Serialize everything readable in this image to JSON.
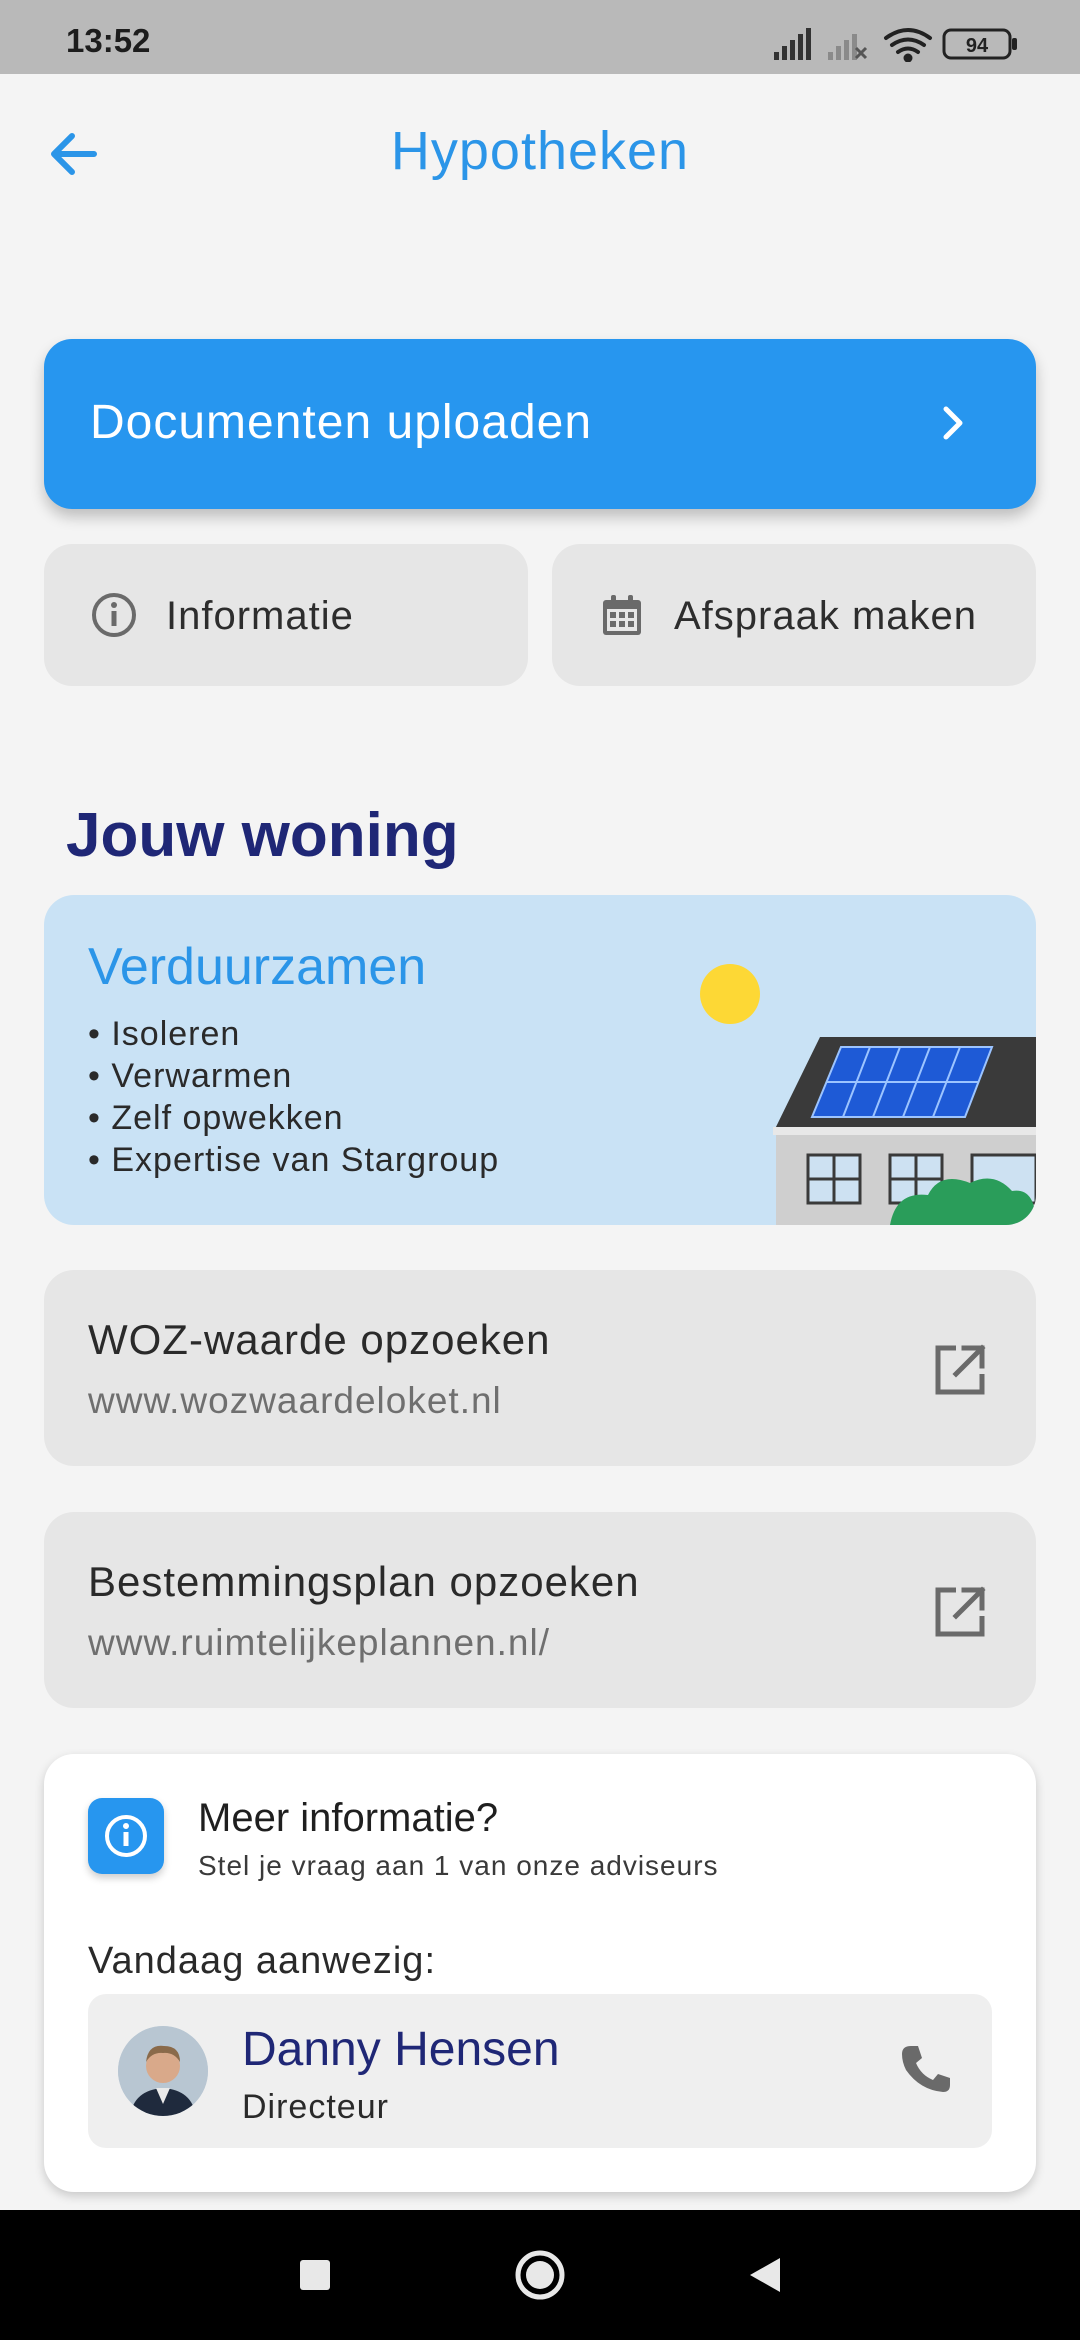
{
  "status_bar": {
    "time": "13:52",
    "battery": "94"
  },
  "header": {
    "title": "Hypotheken",
    "back_icon": "arrow-left-icon"
  },
  "actions": {
    "upload_label": "Documenten uploaden",
    "info_label": "Informatie",
    "appointment_label": "Afspraak maken"
  },
  "section": {
    "title": "Jouw woning"
  },
  "sustain_card": {
    "title": "Verduurzamen",
    "items": [
      "Isoleren",
      "Verwarmen",
      "Zelf opwekken",
      "Expertise van Stargroup"
    ]
  },
  "links": [
    {
      "title": "WOZ-waarde opzoeken",
      "url": "www.wozwaardeloket.nl"
    },
    {
      "title": "Bestemmingsplan opzoeken",
      "url": "www.ruimtelijkeplannen.nl/"
    }
  ],
  "contact": {
    "title": "Meer informatie?",
    "subtitle": "Stel je vraag aan 1 van onze adviseurs",
    "present_label": "Vandaag aanwezig:",
    "advisor_name": "Danny Hensen",
    "advisor_role": "Directeur"
  },
  "colors": {
    "accent": "#2796ef",
    "title_blue": "#2b95e8",
    "navy": "#1f2776",
    "card_gray": "#e6e6e6",
    "light_blue_card": "#c9e2f5"
  }
}
